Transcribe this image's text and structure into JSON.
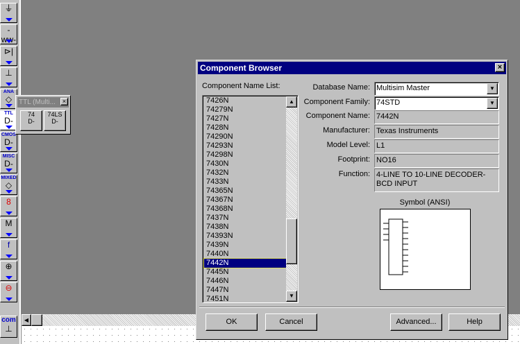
{
  "toolbar": {
    "items": [
      {
        "name": "sources",
        "label": "",
        "glyph": "⏚"
      },
      {
        "name": "basic",
        "label": "",
        "glyph": "-ww-"
      },
      {
        "name": "diodes",
        "label": "",
        "glyph": "⊳|"
      },
      {
        "name": "transistors",
        "label": "",
        "glyph": "⊥"
      },
      {
        "name": "analog",
        "label": "ANA",
        "glyph": "◇"
      },
      {
        "name": "ttl",
        "label": "TTL",
        "glyph": "D-"
      },
      {
        "name": "cmos",
        "label": "CMOS",
        "glyph": "D-"
      },
      {
        "name": "misc-digital",
        "label": "MISC",
        "glyph": "D-"
      },
      {
        "name": "mixed",
        "label": "MIXED",
        "glyph": "◇"
      },
      {
        "name": "indicators",
        "label": "",
        "glyph": "8"
      },
      {
        "name": "misc",
        "label": "",
        "glyph": "M"
      },
      {
        "name": "controls",
        "label": "",
        "glyph": "f"
      },
      {
        "name": "rf",
        "label": "",
        "glyph": "⊕"
      },
      {
        "name": "electromechanical",
        "label": "",
        "glyph": "⊖"
      }
    ],
    "bottom_label": "com"
  },
  "ttl_palette": {
    "title": "TTL (Multi...",
    "buttons": [
      "74",
      "74LS"
    ]
  },
  "dialog": {
    "title": "Component Browser",
    "list_label": "Component Name List:",
    "list_items": [
      "7426N",
      "74279N",
      "7427N",
      "7428N",
      "74290N",
      "74293N",
      "74298N",
      "7430N",
      "7432N",
      "7433N",
      "74365N",
      "74367N",
      "74368N",
      "7437N",
      "7438N",
      "74393N",
      "7439N",
      "7440N",
      "7442N",
      "7445N",
      "7446N",
      "7447N",
      "7451N"
    ],
    "selected_item": "7442N",
    "fields": {
      "database_name": {
        "label": "Database Name:",
        "value": "Multisim Master"
      },
      "component_family": {
        "label": "Component Family:",
        "value": "74STD"
      },
      "component_name": {
        "label": "Component Name:",
        "value": "7442N"
      },
      "manufacturer": {
        "label": "Manufacturer:",
        "value": "Texas Instruments"
      },
      "model_level": {
        "label": "Model Level:",
        "value": "L1"
      },
      "footprint": {
        "label": "Footprint:",
        "value": "NO16"
      },
      "function": {
        "label": "Function:",
        "value": "4-LINE TO 10-LINE DECODER-BCD INPUT"
      }
    },
    "symbol_label": "Symbol (ANSI)",
    "buttons": {
      "ok": "OK",
      "cancel": "Cancel",
      "advanced": "Advanced...",
      "help": "Help"
    }
  }
}
